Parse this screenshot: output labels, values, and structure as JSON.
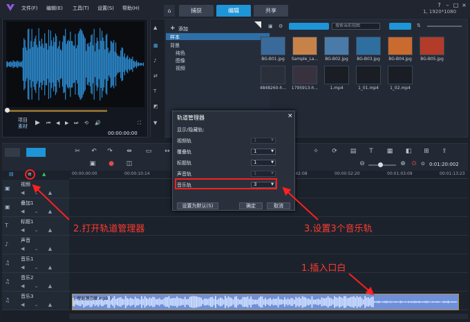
{
  "menu": {
    "items": [
      "文件(F)",
      "编辑(E)",
      "工具(T)",
      "设置(S)",
      "帮助(H)"
    ]
  },
  "tabs": [
    "捕获",
    "编辑",
    "共享"
  ],
  "active_tab": "编辑",
  "resolution": "1, 1920*1080",
  "preview": {
    "mode_project": "项目",
    "mode_clip": "素材",
    "timecode": "00:00:00:00"
  },
  "library": {
    "add_label": "添加",
    "search_placeholder": "搜索当前视图",
    "tree": {
      "root": "样本",
      "group": "背景",
      "children": [
        "纯色",
        "图像",
        "视频"
      ]
    },
    "thumbs": [
      {
        "label": "BG-B01.jpg",
        "color": "#3a6a9a"
      },
      {
        "label": "Sample_La...",
        "color": "#c7824a"
      },
      {
        "label": "BG-B02.jpg",
        "color": "#4a7ba8"
      },
      {
        "label": "BG-B03.jpg",
        "color": "#2f6f9f"
      },
      {
        "label": "BG-B04.jpg",
        "color": "#c96a2f"
      },
      {
        "label": "BG-B05.jpg",
        "color": "#b23b2a"
      },
      {
        "label": "4848260-h...",
        "color": "#2a2f3a"
      },
      {
        "label": "1795913-h...",
        "color": "#38323f"
      },
      {
        "label": "1.mp4",
        "color": "#1a1d24"
      },
      {
        "label": "1_01.mp4",
        "color": "#1a1d24"
      },
      {
        "label": "1_02.mp4",
        "color": "#1a1d24"
      }
    ]
  },
  "timeline": {
    "timecode": "0:01:20:002",
    "ruler": [
      "00:00:00:00",
      "00:00:10:14",
      "00:00:21:04",
      "00:00:31:18",
      "00:00:42:08",
      "00:00:52:20",
      "00:01:03:09",
      "00:01:13:23"
    ],
    "tracks": [
      {
        "name": "视频",
        "icon": "video-track-icon"
      },
      {
        "name": "叠加1",
        "icon": "overlay-track-icon"
      },
      {
        "name": "标题1",
        "icon": "title-track-icon"
      },
      {
        "name": "声音",
        "icon": "voice-track-icon"
      },
      {
        "name": "音乐1",
        "icon": "music-track-icon"
      },
      {
        "name": "音乐2",
        "icon": "music-track-icon"
      },
      {
        "name": "音乐3",
        "icon": "music-track-icon"
      }
    ],
    "clip_label": "[ 慢溜溜恋爱.mp3 ]"
  },
  "dialog": {
    "title": "轨道管理器",
    "subtitle": "显示/隐藏轨:",
    "rows": [
      {
        "label": "视频轨",
        "value": "1",
        "enabled": false
      },
      {
        "label": "覆叠轨",
        "value": "1",
        "enabled": true
      },
      {
        "label": "标题轨",
        "value": "1",
        "enabled": true
      },
      {
        "label": "声音轨",
        "value": "1",
        "enabled": false
      },
      {
        "label": "音乐轨",
        "value": "3",
        "enabled": true
      }
    ],
    "buttons": {
      "default": "设置为默认(S)",
      "ok": "确定",
      "cancel": "取消"
    }
  },
  "annotations": {
    "step1": "1.插入口白",
    "step2": "2.打开轨道管理器",
    "step3": "3.设置3个音乐轨"
  },
  "colors": {
    "accent": "#1e95d6",
    "waveform": "#2e8fd6",
    "clip": "#6f8fd8",
    "annotation": "#ff3b2f"
  }
}
